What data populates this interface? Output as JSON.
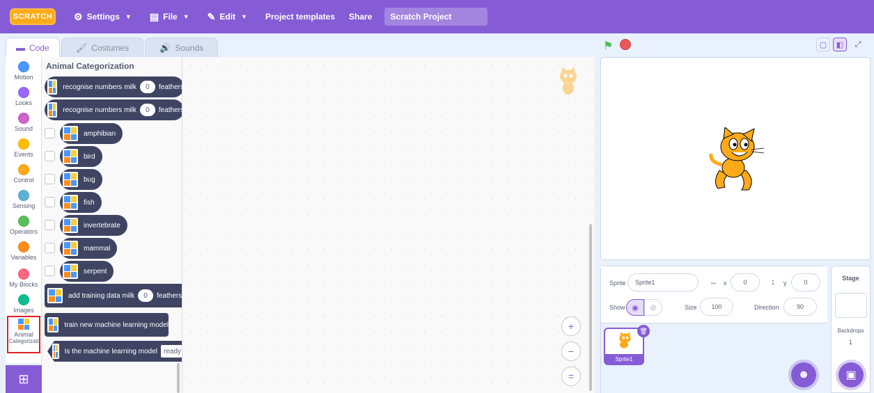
{
  "menubar": {
    "logo_text": "SCRATCH",
    "settings": "Settings",
    "file": "File",
    "edit": "Edit",
    "project_templates": "Project templates",
    "share": "Share",
    "project_title": "Scratch Project"
  },
  "tabs": {
    "code": "Code",
    "costumes": "Costumes",
    "sounds": "Sounds"
  },
  "categories": [
    {
      "label": "Motion",
      "color": "#4c97ff"
    },
    {
      "label": "Looks",
      "color": "#9966ff"
    },
    {
      "label": "Sound",
      "color": "#cf63cf"
    },
    {
      "label": "Events",
      "color": "#ffbf00"
    },
    {
      "label": "Control",
      "color": "#ffab19"
    },
    {
      "label": "Sensing",
      "color": "#5cb1d6"
    },
    {
      "label": "Operators",
      "color": "#59c059"
    },
    {
      "label": "Variables",
      "color": "#ff8c1a"
    },
    {
      "label": "My Blocks",
      "color": "#ff6680"
    },
    {
      "label": "Images",
      "color": "#0fbd8c"
    }
  ],
  "animal_category": {
    "line1": "Animal",
    "line2": "Categorizati"
  },
  "palette": {
    "title": "Animal Categorization",
    "recognise1": {
      "text": "recognise numbers",
      "milk": "milk",
      "value": "0",
      "feathers": "feathers"
    },
    "recognise2": {
      "text": "recognise numbers",
      "milk": "milk",
      "value": "0",
      "feathers": "feathers"
    },
    "labels": [
      "amphibian",
      "bird",
      "bug",
      "fish",
      "invertebrate",
      "mammal",
      "serpent"
    ],
    "add_training": {
      "text": "add training data",
      "milk": "milk",
      "value": "0",
      "feathers": "feathers"
    },
    "train": "train new machine learning model",
    "is_model": {
      "text": "Is the machine learning model",
      "value": "ready"
    }
  },
  "zoom": {
    "in": "+",
    "out": "−",
    "reset": "="
  },
  "sprite_info": {
    "sprite_label": "Sprite",
    "sprite_name": "Sprite1",
    "x_label": "x",
    "x_value": "0",
    "y_label": "y",
    "y_value": "0",
    "show_label": "Show",
    "size_label": "Size",
    "size_value": "100",
    "direction_label": "Direction",
    "direction_value": "90"
  },
  "sprite_list": {
    "thumb_label": "Sprite1"
  },
  "stage_pane": {
    "title": "Stage",
    "backdrops_label": "Backdrops",
    "backdrops_count": "1"
  },
  "colors": {
    "accent": "#855cd6",
    "block": "#3e4462",
    "flag": "#4cbf56",
    "stop": "#ec5959"
  }
}
